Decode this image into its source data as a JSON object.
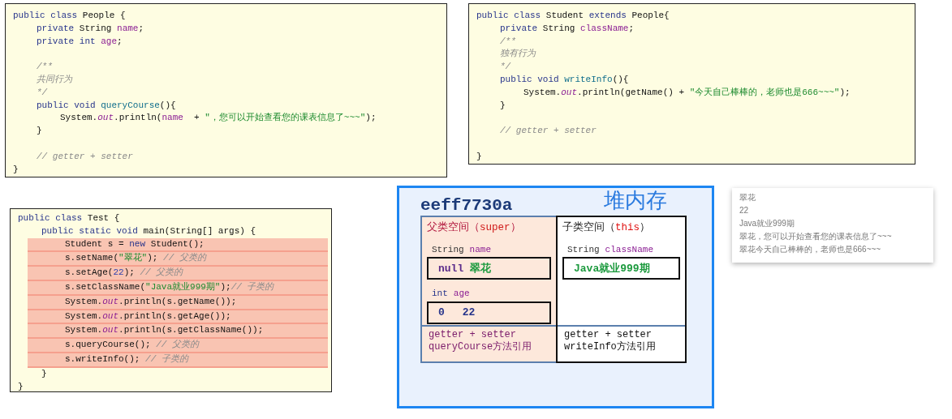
{
  "code_panels": [
    {
      "lines": [
        {
          "kind": "code",
          "tokens": [
            {
              "kind": "kw",
              "text": "public class"
            },
            {
              "kind": "pl",
              "text": " People {"
            }
          ],
          "children": [
            {
              "kind": "code",
              "tokens": [
                {
                  "kind": "kw",
                  "text": "private"
                },
                {
                  "kind": "pl",
                  "text": " String "
                },
                {
                  "kind": "fd",
                  "text": "name"
                },
                {
                  "kind": "pl",
                  "text": ";"
                }
              ]
            },
            {
              "kind": "code",
              "tokens": [
                {
                  "kind": "kw",
                  "text": "private int "
                },
                {
                  "kind": "fd",
                  "text": "age"
                },
                {
                  "kind": "pl",
                  "text": ";"
                }
              ]
            },
            {
              "kind": "blank"
            },
            {
              "kind": "code",
              "tokens": [
                {
                  "kind": "cm",
                  "text": "/**"
                }
              ]
            },
            {
              "kind": "code",
              "tokens": [
                {
                  "kind": "cm",
                  "text": "共同行为"
                }
              ]
            },
            {
              "kind": "code",
              "tokens": [
                {
                  "kind": "cm",
                  "text": "*/"
                }
              ]
            },
            {
              "kind": "code",
              "tokens": [
                {
                  "kind": "kw",
                  "text": "public void "
                },
                {
                  "kind": "md",
                  "text": "queryCourse"
                },
                {
                  "kind": "pl",
                  "text": "(){"
                }
              ],
              "children": [
                {
                  "kind": "code",
                  "tokens": [
                    {
                      "kind": "pl",
                      "text": "System."
                    },
                    {
                      "kind": "st",
                      "text": "out"
                    },
                    {
                      "kind": "pl",
                      "text": ".println("
                    },
                    {
                      "kind": "fd",
                      "text": "name"
                    },
                    {
                      "kind": "pl",
                      "text": "  + "
                    },
                    {
                      "kind": "str",
                      "text": "\"，您可以开始查看您的课表信息了~~~\""
                    },
                    {
                      "kind": "pl",
                      "text": ");"
                    }
                  ]
                }
              ]
            },
            {
              "kind": "code",
              "tokens": [
                {
                  "kind": "pl",
                  "text": "}"
                }
              ]
            },
            {
              "kind": "blank"
            },
            {
              "kind": "code",
              "tokens": [
                {
                  "kind": "cm",
                  "text": "// getter + setter"
                }
              ]
            }
          ]
        },
        {
          "kind": "code",
          "tokens": [
            {
              "kind": "pl",
              "text": "}"
            }
          ]
        }
      ]
    },
    {
      "lines": [
        {
          "kind": "code",
          "tokens": [
            {
              "kind": "kw",
              "text": "public class"
            },
            {
              "kind": "pl",
              "text": " Student "
            },
            {
              "kind": "kw",
              "text": "extends"
            },
            {
              "kind": "pl",
              "text": " People{"
            }
          ],
          "children": [
            {
              "kind": "code",
              "tokens": [
                {
                  "kind": "kw",
                  "text": "private"
                },
                {
                  "kind": "pl",
                  "text": " String "
                },
                {
                  "kind": "fd",
                  "text": "className"
                },
                {
                  "kind": "pl",
                  "text": ";"
                }
              ]
            },
            {
              "kind": "code",
              "tokens": [
                {
                  "kind": "cm",
                  "text": "/**"
                }
              ]
            },
            {
              "kind": "code",
              "tokens": [
                {
                  "kind": "cm",
                  "text": "独有行为"
                }
              ]
            },
            {
              "kind": "code",
              "tokens": [
                {
                  "kind": "cm",
                  "text": "*/"
                }
              ]
            },
            {
              "kind": "code",
              "tokens": [
                {
                  "kind": "kw",
                  "text": "public void "
                },
                {
                  "kind": "md",
                  "text": "writeInfo"
                },
                {
                  "kind": "pl",
                  "text": "(){"
                }
              ],
              "children": [
                {
                  "kind": "code",
                  "tokens": [
                    {
                      "kind": "pl",
                      "text": "System."
                    },
                    {
                      "kind": "st",
                      "text": "out"
                    },
                    {
                      "kind": "pl",
                      "text": ".println(getName() + "
                    },
                    {
                      "kind": "str",
                      "text": "\"今天自己棒棒的，老师也是666~~~\""
                    },
                    {
                      "kind": "pl",
                      "text": ");"
                    }
                  ]
                }
              ]
            },
            {
              "kind": "code",
              "tokens": [
                {
                  "kind": "pl",
                  "text": "}"
                }
              ]
            },
            {
              "kind": "blank"
            },
            {
              "kind": "code",
              "tokens": [
                {
                  "kind": "cm",
                  "text": "// getter + setter"
                }
              ]
            },
            {
              "kind": "blank"
            }
          ]
        },
        {
          "kind": "code",
          "tokens": [
            {
              "kind": "pl",
              "text": "}"
            }
          ]
        }
      ]
    },
    {
      "lines": [
        {
          "kind": "code",
          "highlighted": false,
          "tokens": [
            {
              "kind": "kw",
              "text": "public class"
            },
            {
              "kind": "pl",
              "text": " Test {"
            }
          ],
          "children": [
            {
              "kind": "code",
              "highlighted": false,
              "tokens": [
                {
                  "kind": "kw",
                  "text": "public static void"
                },
                {
                  "kind": "pl",
                  "text": " main(String[] args) {"
                }
              ],
              "children": [
                {
                  "kind": "code",
                  "highlighted": true,
                  "tokens": [
                    {
                      "kind": "pl",
                      "text": "Student s = "
                    },
                    {
                      "kind": "kw",
                      "text": "new"
                    },
                    {
                      "kind": "pl",
                      "text": " Student();"
                    }
                  ]
                },
                {
                  "kind": "code",
                  "highlighted": true,
                  "tokens": [
                    {
                      "kind": "pl",
                      "text": "s.setName("
                    },
                    {
                      "kind": "str",
                      "text": "\"翠花\""
                    },
                    {
                      "kind": "pl",
                      "text": "); "
                    },
                    {
                      "kind": "cm",
                      "text": "// 父类的"
                    }
                  ]
                },
                {
                  "kind": "code",
                  "highlighted": true,
                  "tokens": [
                    {
                      "kind": "pl",
                      "text": "s.setAge("
                    },
                    {
                      "kind": "num",
                      "text": "22"
                    },
                    {
                      "kind": "pl",
                      "text": "); "
                    },
                    {
                      "kind": "cm",
                      "text": "// 父类的"
                    }
                  ]
                },
                {
                  "kind": "code",
                  "highlighted": true,
                  "tokens": [
                    {
                      "kind": "pl",
                      "text": "s.setClassName("
                    },
                    {
                      "kind": "str",
                      "text": "\"Java就业999期\""
                    },
                    {
                      "kind": "pl",
                      "text": ");"
                    },
                    {
                      "kind": "cm",
                      "text": "// 子类的"
                    }
                  ]
                },
                {
                  "kind": "code",
                  "highlighted": true,
                  "tokens": [
                    {
                      "kind": "pl",
                      "text": "System."
                    },
                    {
                      "kind": "st",
                      "text": "out"
                    },
                    {
                      "kind": "pl",
                      "text": ".println(s.getName());"
                    }
                  ]
                },
                {
                  "kind": "code",
                  "highlighted": true,
                  "tokens": [
                    {
                      "kind": "pl",
                      "text": "System."
                    },
                    {
                      "kind": "st",
                      "text": "out"
                    },
                    {
                      "kind": "pl",
                      "text": ".println(s.getAge());"
                    }
                  ]
                },
                {
                  "kind": "code",
                  "highlighted": true,
                  "tokens": [
                    {
                      "kind": "pl",
                      "text": "System."
                    },
                    {
                      "kind": "st",
                      "text": "out"
                    },
                    {
                      "kind": "pl",
                      "text": ".println(s.getClassName());"
                    }
                  ]
                },
                {
                  "kind": "code",
                  "highlighted": true,
                  "tokens": [
                    {
                      "kind": "pl",
                      "text": "s.queryCourse(); "
                    },
                    {
                      "kind": "cm",
                      "text": "// 父类的"
                    }
                  ]
                },
                {
                  "kind": "code",
                  "highlighted": true,
                  "tokens": [
                    {
                      "kind": "pl",
                      "text": "s.writeInfo(); "
                    },
                    {
                      "kind": "cm",
                      "text": "// 子类的"
                    }
                  ]
                }
              ]
            },
            {
              "kind": "code",
              "highlighted": false,
              "tokens": [
                {
                  "kind": "pl",
                  "text": "}"
                }
              ]
            }
          ]
        },
        {
          "kind": "code",
          "highlighted": false,
          "tokens": [
            {
              "kind": "pl",
              "text": "}"
            }
          ]
        }
      ]
    }
  ],
  "heap": {
    "address": "eeff7730a",
    "title": "堆内存",
    "parent": {
      "label": "父类空间（",
      "keyword": "super",
      "label_end": "）",
      "fields": [
        {
          "type": "String",
          "name": "name",
          "old": "null",
          "new": "翠花"
        },
        {
          "type": "int",
          "name": "age",
          "old": "0",
          "new": "22"
        }
      ],
      "methods": [
        "getter + setter",
        "queryCourse方法引用"
      ]
    },
    "child": {
      "label": "子类空间（",
      "keyword": "this",
      "label_end": "）",
      "fields": [
        {
          "type": "String",
          "name": "className",
          "new": "Java就业999期"
        }
      ],
      "methods": [
        "getter + setter",
        "writeInfo方法引用"
      ]
    }
  },
  "console": {
    "lines": [
      "翠花",
      "22",
      "Java就业999期",
      "翠花，您可以开始查看您的课表信息了~~~",
      "翠花今天自己棒棒的，老师也是666~~~"
    ]
  }
}
